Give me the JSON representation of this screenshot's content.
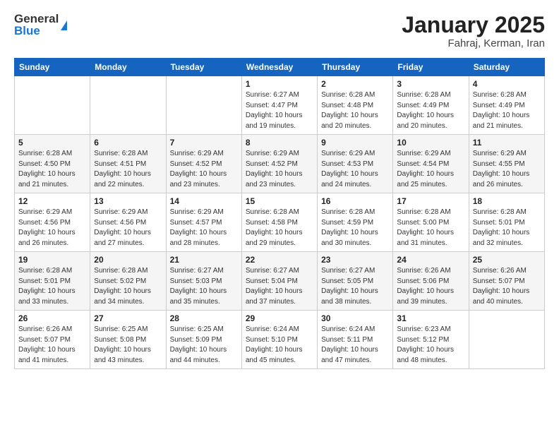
{
  "header": {
    "logo_general": "General",
    "logo_blue": "Blue",
    "month_title": "January 2025",
    "subtitle": "Fahraj, Kerman, Iran"
  },
  "weekdays": [
    "Sunday",
    "Monday",
    "Tuesday",
    "Wednesday",
    "Thursday",
    "Friday",
    "Saturday"
  ],
  "weeks": [
    [
      {
        "num": "",
        "info": ""
      },
      {
        "num": "",
        "info": ""
      },
      {
        "num": "",
        "info": ""
      },
      {
        "num": "1",
        "info": "Sunrise: 6:27 AM\nSunset: 4:47 PM\nDaylight: 10 hours\nand 19 minutes."
      },
      {
        "num": "2",
        "info": "Sunrise: 6:28 AM\nSunset: 4:48 PM\nDaylight: 10 hours\nand 20 minutes."
      },
      {
        "num": "3",
        "info": "Sunrise: 6:28 AM\nSunset: 4:49 PM\nDaylight: 10 hours\nand 20 minutes."
      },
      {
        "num": "4",
        "info": "Sunrise: 6:28 AM\nSunset: 4:49 PM\nDaylight: 10 hours\nand 21 minutes."
      }
    ],
    [
      {
        "num": "5",
        "info": "Sunrise: 6:28 AM\nSunset: 4:50 PM\nDaylight: 10 hours\nand 21 minutes."
      },
      {
        "num": "6",
        "info": "Sunrise: 6:28 AM\nSunset: 4:51 PM\nDaylight: 10 hours\nand 22 minutes."
      },
      {
        "num": "7",
        "info": "Sunrise: 6:29 AM\nSunset: 4:52 PM\nDaylight: 10 hours\nand 23 minutes."
      },
      {
        "num": "8",
        "info": "Sunrise: 6:29 AM\nSunset: 4:52 PM\nDaylight: 10 hours\nand 23 minutes."
      },
      {
        "num": "9",
        "info": "Sunrise: 6:29 AM\nSunset: 4:53 PM\nDaylight: 10 hours\nand 24 minutes."
      },
      {
        "num": "10",
        "info": "Sunrise: 6:29 AM\nSunset: 4:54 PM\nDaylight: 10 hours\nand 25 minutes."
      },
      {
        "num": "11",
        "info": "Sunrise: 6:29 AM\nSunset: 4:55 PM\nDaylight: 10 hours\nand 26 minutes."
      }
    ],
    [
      {
        "num": "12",
        "info": "Sunrise: 6:29 AM\nSunset: 4:56 PM\nDaylight: 10 hours\nand 26 minutes."
      },
      {
        "num": "13",
        "info": "Sunrise: 6:29 AM\nSunset: 4:56 PM\nDaylight: 10 hours\nand 27 minutes."
      },
      {
        "num": "14",
        "info": "Sunrise: 6:29 AM\nSunset: 4:57 PM\nDaylight: 10 hours\nand 28 minutes."
      },
      {
        "num": "15",
        "info": "Sunrise: 6:28 AM\nSunset: 4:58 PM\nDaylight: 10 hours\nand 29 minutes."
      },
      {
        "num": "16",
        "info": "Sunrise: 6:28 AM\nSunset: 4:59 PM\nDaylight: 10 hours\nand 30 minutes."
      },
      {
        "num": "17",
        "info": "Sunrise: 6:28 AM\nSunset: 5:00 PM\nDaylight: 10 hours\nand 31 minutes."
      },
      {
        "num": "18",
        "info": "Sunrise: 6:28 AM\nSunset: 5:01 PM\nDaylight: 10 hours\nand 32 minutes."
      }
    ],
    [
      {
        "num": "19",
        "info": "Sunrise: 6:28 AM\nSunset: 5:01 PM\nDaylight: 10 hours\nand 33 minutes."
      },
      {
        "num": "20",
        "info": "Sunrise: 6:28 AM\nSunset: 5:02 PM\nDaylight: 10 hours\nand 34 minutes."
      },
      {
        "num": "21",
        "info": "Sunrise: 6:27 AM\nSunset: 5:03 PM\nDaylight: 10 hours\nand 35 minutes."
      },
      {
        "num": "22",
        "info": "Sunrise: 6:27 AM\nSunset: 5:04 PM\nDaylight: 10 hours\nand 37 minutes."
      },
      {
        "num": "23",
        "info": "Sunrise: 6:27 AM\nSunset: 5:05 PM\nDaylight: 10 hours\nand 38 minutes."
      },
      {
        "num": "24",
        "info": "Sunrise: 6:26 AM\nSunset: 5:06 PM\nDaylight: 10 hours\nand 39 minutes."
      },
      {
        "num": "25",
        "info": "Sunrise: 6:26 AM\nSunset: 5:07 PM\nDaylight: 10 hours\nand 40 minutes."
      }
    ],
    [
      {
        "num": "26",
        "info": "Sunrise: 6:26 AM\nSunset: 5:07 PM\nDaylight: 10 hours\nand 41 minutes."
      },
      {
        "num": "27",
        "info": "Sunrise: 6:25 AM\nSunset: 5:08 PM\nDaylight: 10 hours\nand 43 minutes."
      },
      {
        "num": "28",
        "info": "Sunrise: 6:25 AM\nSunset: 5:09 PM\nDaylight: 10 hours\nand 44 minutes."
      },
      {
        "num": "29",
        "info": "Sunrise: 6:24 AM\nSunset: 5:10 PM\nDaylight: 10 hours\nand 45 minutes."
      },
      {
        "num": "30",
        "info": "Sunrise: 6:24 AM\nSunset: 5:11 PM\nDaylight: 10 hours\nand 47 minutes."
      },
      {
        "num": "31",
        "info": "Sunrise: 6:23 AM\nSunset: 5:12 PM\nDaylight: 10 hours\nand 48 minutes."
      },
      {
        "num": "",
        "info": ""
      }
    ]
  ]
}
